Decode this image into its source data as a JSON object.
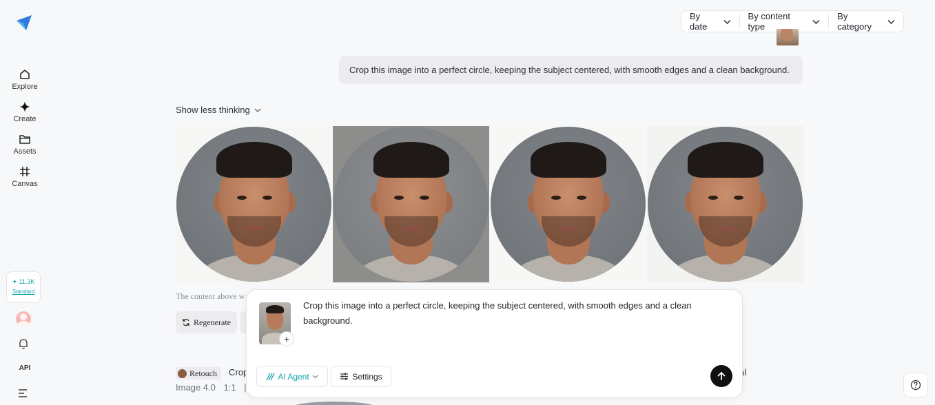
{
  "sidebar": {
    "items": [
      {
        "label": "Explore",
        "icon": "home-icon"
      },
      {
        "label": "Create",
        "icon": "sparkle-icon"
      },
      {
        "label": "Assets",
        "icon": "folder-icon"
      },
      {
        "label": "Canvas",
        "icon": "grid-frame-icon"
      }
    ],
    "credits": "11.3K",
    "tier": "Standard",
    "api_label": "API"
  },
  "filters": {
    "by_date": "By date",
    "by_content_type": "By content type",
    "by_category": "By category"
  },
  "conversation": {
    "prompt": "Crop this image into a perfect circle, keeping the subject centered, with smooth edges and a clean background.",
    "thinking_toggle": "Show less thinking",
    "content_note": "The content above w",
    "regenerate_label": "Regenerate",
    "next_tag": "Retouch",
    "next_peek": "Crop",
    "next_peek_right": "al",
    "meta": [
      "Image 4.0",
      "1:1",
      "|"
    ]
  },
  "composer": {
    "text": "Crop this image into a perfect circle, keeping the subject centered, with smooth edges and a clean background.",
    "agent_label": "AI Agent",
    "settings_label": "Settings"
  },
  "colors": {
    "accent": "#12a3a8",
    "send": "#111111"
  }
}
